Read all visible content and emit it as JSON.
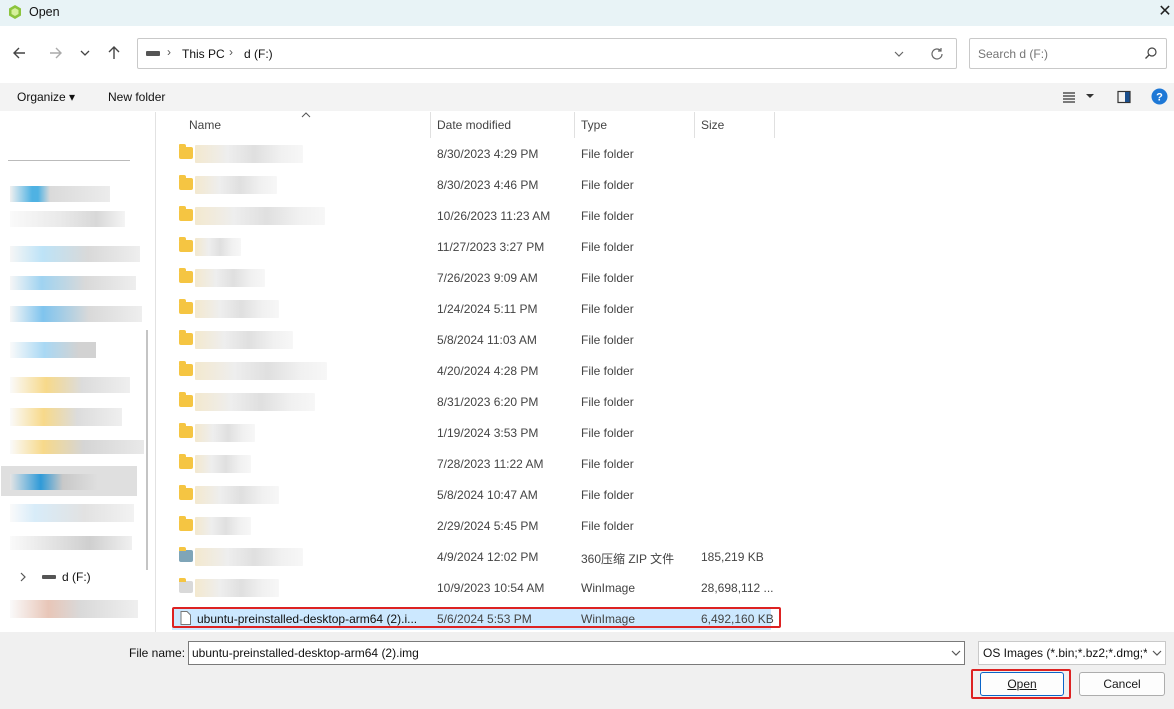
{
  "window": {
    "title": "Open",
    "close_glyph": "✕"
  },
  "nav": {
    "back_icon": "arrow-left-icon",
    "forward_icon": "arrow-right-icon",
    "recent_icon": "chevron-down-icon",
    "up_icon": "arrow-up-icon"
  },
  "address": {
    "crumbs": [
      "This PC",
      "d (F:)"
    ],
    "separator": "›"
  },
  "search": {
    "placeholder": "Search d (F:)"
  },
  "toolbar": {
    "organize": "Organize ▾",
    "new_folder": "New folder"
  },
  "sidebar": {
    "drive_label": "d (F:)"
  },
  "columns": {
    "name": "Name",
    "date": "Date modified",
    "type": "Type",
    "size": "Size"
  },
  "rows": [
    {
      "date": "8/30/2023 4:29 PM",
      "type": "File folder",
      "size": ""
    },
    {
      "date": "8/30/2023 4:46 PM",
      "type": "File folder",
      "size": ""
    },
    {
      "date": "10/26/2023 11:23 AM",
      "type": "File folder",
      "size": ""
    },
    {
      "date": "11/27/2023 3:27 PM",
      "type": "File folder",
      "size": ""
    },
    {
      "date": "7/26/2023 9:09 AM",
      "type": "File folder",
      "size": ""
    },
    {
      "date": "1/24/2024 5:11 PM",
      "type": "File folder",
      "size": ""
    },
    {
      "date": "5/8/2024 11:03 AM",
      "type": "File folder",
      "size": ""
    },
    {
      "date": "4/20/2024 4:28 PM",
      "type": "File folder",
      "size": ""
    },
    {
      "date": "8/31/2023 6:20 PM",
      "type": "File folder",
      "size": ""
    },
    {
      "date": "1/19/2024 3:53 PM",
      "type": "File folder",
      "size": ""
    },
    {
      "date": "7/28/2023 11:22 AM",
      "type": "File folder",
      "size": ""
    },
    {
      "date": "5/8/2024 10:47 AM",
      "type": "File folder",
      "size": ""
    },
    {
      "date": "2/29/2024 5:45 PM",
      "type": "File folder",
      "size": ""
    },
    {
      "date": "4/9/2024 12:02 PM",
      "type": "360压缩 ZIP 文件",
      "size": "185,219 KB"
    },
    {
      "date": "10/9/2023 10:54 AM",
      "type": "WinImage",
      "size": "28,698,112 ..."
    }
  ],
  "selected_row": {
    "name": "ubuntu-preinstalled-desktop-arm64 (2).i...",
    "date": "5/6/2024 5:53 PM",
    "type": "WinImage",
    "size": "6,492,160 KB"
  },
  "bottom": {
    "file_name_label": "File name:",
    "file_name_value": "ubuntu-preinstalled-desktop-arm64 (2).img",
    "file_type_value": "OS Images (*.bin;*.bz2;*.dmg;*.",
    "open_label": "Open",
    "cancel_label": "Cancel"
  },
  "colors": {
    "highlight": "#cce8ff",
    "annotation_red": "#d22222",
    "folder": "#f5c542"
  }
}
